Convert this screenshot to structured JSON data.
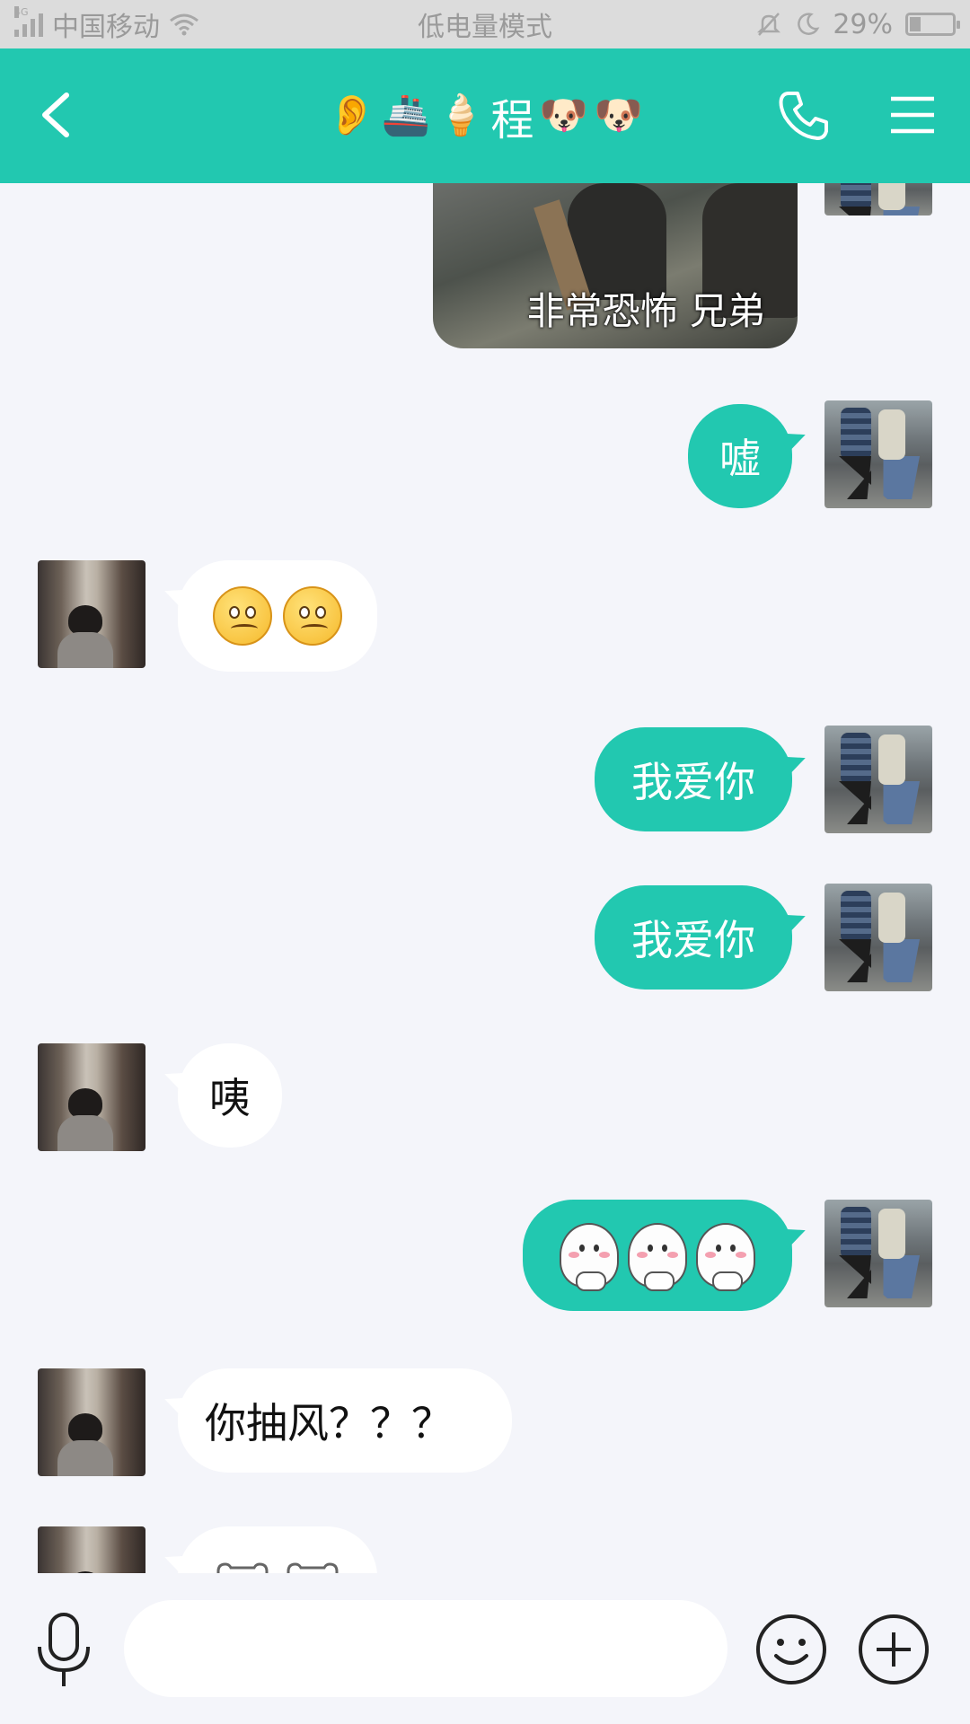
{
  "status_bar": {
    "network_type": "4G",
    "carrier": "中国移动",
    "mode": "低电量模式",
    "battery": "29%"
  },
  "header": {
    "title_emojis": [
      "👂",
      "🚢",
      "🍦"
    ],
    "contact_name": "程",
    "title_emojis_after": [
      "🐶",
      "🐶"
    ],
    "accent_color": "#22c8b0"
  },
  "messages": [
    {
      "side": "me",
      "type": "image",
      "caption": "非常恐怖   兄弟"
    },
    {
      "side": "me",
      "type": "text",
      "text": "嘘"
    },
    {
      "side": "other",
      "type": "emoji",
      "emoji": [
        "worried-face-icon",
        "worried-face-icon"
      ]
    },
    {
      "side": "me",
      "type": "text",
      "text": "我爱你"
    },
    {
      "side": "me",
      "type": "text",
      "text": "我爱你"
    },
    {
      "side": "other",
      "type": "text",
      "text": "咦"
    },
    {
      "side": "me",
      "type": "emoji",
      "emoji": [
        "shy-ghost-icon",
        "shy-ghost-icon",
        "shy-ghost-icon"
      ]
    },
    {
      "side": "other",
      "type": "text",
      "text": "你抽风？？？"
    },
    {
      "side": "other",
      "type": "emoji",
      "emoji": [
        "bear-face-icon",
        "bear-face-icon"
      ]
    }
  ],
  "input_bar": {
    "placeholder": "",
    "value": ""
  }
}
